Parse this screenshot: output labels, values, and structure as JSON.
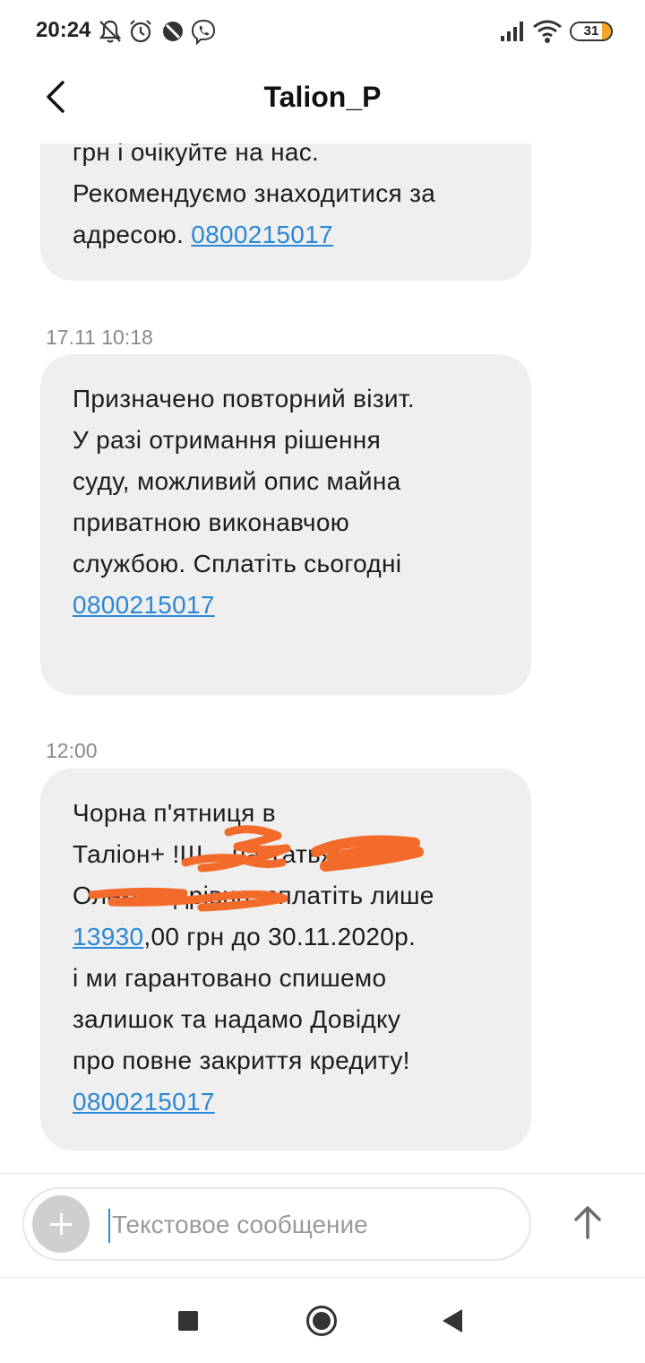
{
  "status_bar": {
    "time": "20:24",
    "battery_level": "31",
    "battery_percent": 31,
    "icons": [
      "bell-off-icon",
      "alarm-icon",
      "do-not-disturb-icon",
      "viber-icon",
      "signal-icon",
      "wifi-icon",
      "battery-icon"
    ]
  },
  "header": {
    "title": "Talion_P",
    "back_icon": "chevron-left-icon"
  },
  "messages": [
    {
      "lines": [
        "грн і очікуйте на нас.",
        "Рекомендуємо знаходитися за",
        "адресою. "
      ],
      "link": "0800215017"
    },
    {
      "timestamp": "17.11 10:18",
      "lines": [
        "Призначено повторний візит.",
        "У разі отримання рішення",
        "суду, можливий опис майна",
        "приватною виконавчою",
        "службою. Сплатіть сьогодні"
      ],
      "link": "0800215017"
    },
    {
      "timestamp": "12:00",
      "lines": [
        "Чорна п'ятниця в",
        "Таліон+ !Ш    на Татьяна",
        "Олександрівна, сплатіть лише"
      ],
      "amount_link": "13930",
      "amount_rest": ",00 грн до 30.11.2020р.",
      "lines_after": [
        "і ми гарантовано спишемо",
        "залишок та надамо Довідку",
        "про повне закриття кредиту!"
      ],
      "link": "0800215017"
    }
  ],
  "composer": {
    "placeholder": "Текстовое сообщение",
    "value": "",
    "add_icon": "plus-icon",
    "send_icon": "arrow-up-icon"
  },
  "navigation": {
    "icons": [
      "square-recents-icon",
      "circle-home-icon",
      "triangle-back-icon"
    ]
  },
  "colors": {
    "bubble": "#efefef",
    "link": "#2a88d8",
    "redaction": "#f26b2a",
    "timestamp": "#8a8a8a"
  }
}
